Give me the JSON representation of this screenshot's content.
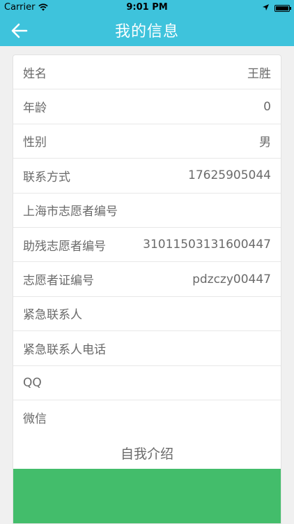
{
  "status": {
    "carrier": "Carrier",
    "time": "9:01 PM",
    "icons": [
      "wifi-icon",
      "location-arrow-icon",
      "battery-icon"
    ]
  },
  "nav": {
    "title": "我的信息",
    "back_icon": "arrow-left-icon"
  },
  "rows": [
    {
      "label": "姓名",
      "value": "王胜"
    },
    {
      "label": "年龄",
      "value": "0"
    },
    {
      "label": "性别",
      "value": "男"
    },
    {
      "label": "联系方式",
      "value": "17625905044"
    },
    {
      "label": "上海市志愿者编号",
      "value": ""
    },
    {
      "label": "助残志愿者编号",
      "value": "31011503131600447"
    },
    {
      "label": "志愿者证编号",
      "value": "pdzczy00447"
    },
    {
      "label": "紧急联系人",
      "value": ""
    },
    {
      "label": "紧急联系人电话",
      "value": ""
    },
    {
      "label": "QQ",
      "value": ""
    },
    {
      "label": "微信",
      "value": ""
    }
  ],
  "intro": {
    "heading": "自我介绍"
  },
  "colors": {
    "header": "#3ec3dc",
    "green_bar": "#43bd6b"
  }
}
